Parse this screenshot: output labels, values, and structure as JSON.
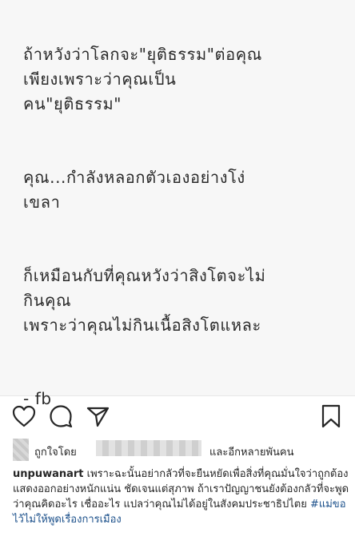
{
  "post": {
    "quote_paragraphs": [
      "ถ้าหวังว่าโลกจะ\"ยุติธรรม\"ต่อคุณ\nเพียงเพราะว่าคุณเป็น\nคน\"ยุติธรรม\"",
      "คุณ...กำลังหลอกตัวเองอย่างโง่\nเขลา",
      "ก็เหมือนกับที่คุณหวังว่าสิงโตจะไม่\nกินคุณ\nเพราะว่าคุณไม่กินเนื้อสิงโตแหละ"
    ],
    "signature": "- fb"
  },
  "actions": {
    "icons": [
      "heart-icon",
      "comment-icon",
      "share-icon",
      "bookmark-icon"
    ]
  },
  "likes": {
    "liked_by_label": "ถูกใจโดย",
    "others_label": "และอีกหลายพันคน"
  },
  "caption": {
    "username": "unpuwanart",
    "text": " เพราะฉะนั้นอย่ากลัวที่จะยืนหยัดเพื่อสิ่งที่คุณมั่นใจว่าถูกต้อง แสดงออกอย่างหนักแน่น ชัดเจนแต่สุภาพ  ถ้าเราปัญญาชนยังต้องกลัวที่จะพูดว่าคุณคิดอะไร เชื่ออะไร แปลว่าคุณไม่ได้อยู่ในสังคมประชาธิปไตย ",
    "hashtag": "#แม่ขอไว้ไม่ให้พูดเรื่องการเมือง"
  }
}
